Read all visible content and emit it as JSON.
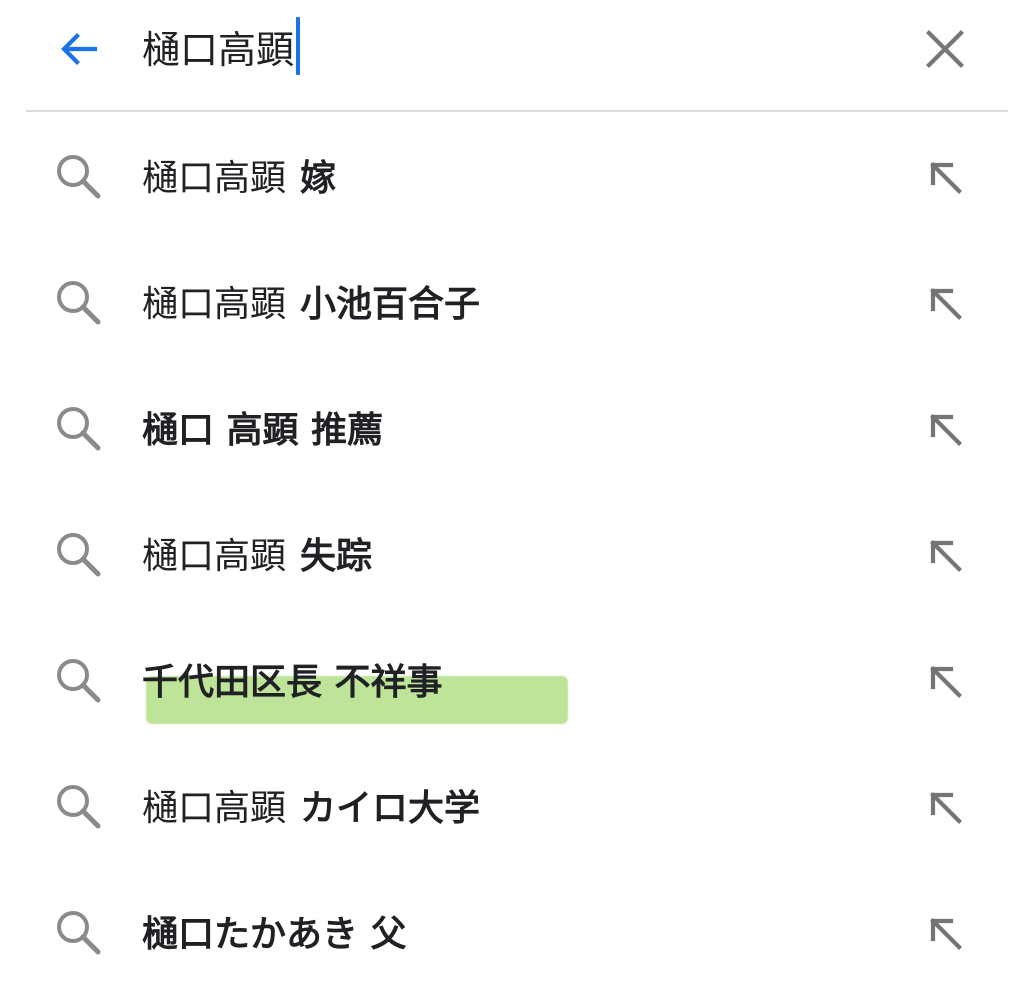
{
  "search": {
    "query": "樋口高顕"
  },
  "icons": {
    "back": "arrow-back-icon",
    "clear": "close-icon",
    "suggestion_leading": "search-icon",
    "suggestion_trailing": "arrow-up-left-icon"
  },
  "colors": {
    "accent": "#1a73e8",
    "icon_gray": "#757575",
    "divider": "#dadce0",
    "highlight": "#a9dc78",
    "text": "#202124"
  },
  "suggestions": [
    {
      "normal": "樋口高顕",
      "bold": "嫁"
    },
    {
      "normal": "樋口高顕",
      "bold": "小池百合子"
    },
    {
      "normal": "",
      "bold": "樋口 高顕 推薦"
    },
    {
      "normal": "樋口高顕",
      "bold": "失踪"
    },
    {
      "normal": "",
      "bold": "千代田区長 不祥事"
    },
    {
      "normal": "樋口高顕",
      "bold": "カイロ大学",
      "highlighted": true
    },
    {
      "normal": "",
      "bold": "樋口たかあき 父"
    }
  ]
}
